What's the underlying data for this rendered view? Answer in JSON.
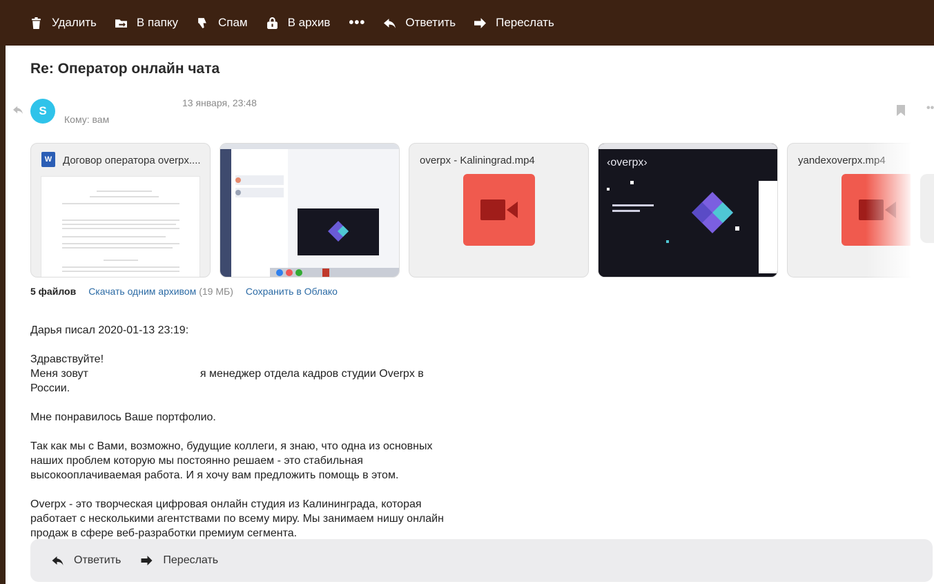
{
  "toolbar": {
    "delete": "Удалить",
    "to_folder": "В папку",
    "spam": "Спам",
    "archive": "В архив",
    "more": "•••",
    "reply": "Ответить",
    "forward": "Переслать"
  },
  "message": {
    "subject": "Re: Оператор онлайн чата",
    "avatar_letter": "S",
    "avatar_color": "#2fc3ea",
    "date": "13 января, 23:48",
    "to": "Кому: вам"
  },
  "attachments": [
    {
      "name": "Договор оператора overpx....",
      "type": "doc"
    },
    {
      "name": "",
      "type": "image"
    },
    {
      "name": "overpx - Kaliningrad.mp4",
      "type": "video"
    },
    {
      "name": "",
      "type": "image"
    },
    {
      "name": "yandexoverpx.mp4",
      "type": "video"
    }
  ],
  "files": {
    "count": "5 файлов",
    "download_all": "Скачать одним архивом",
    "size": "(19 МБ)",
    "save_cloud": "Сохранить в Облако"
  },
  "body": {
    "quote_header": "Дарья писал 2020-01-13 23:19:",
    "greeting": "Здравствуйте!",
    "intro_a": "Меня зовут",
    "intro_b": "я менеджер отдела кадров студии Overpx в России.",
    "p2": "Мне понравилось Ваше портфолио.",
    "p3": "Так как мы с Вами, возможно, будущие коллеги, я знаю, что одна из основных наших проблем которую мы постоянно решаем - это стабильная высокооплачиваемая работа. И я хочу вам предложить помощь в этом.",
    "p4": "Overpx - это творческая цифровая онлайн студия из Калининграда, которая работает с несколькими агентствами по всему миру. Мы занимаем нишу онлайн продаж в сфере веб-разработки премиум сегмента."
  },
  "reply_bar": {
    "reply": "Ответить",
    "forward": "Переслать"
  },
  "colors": {
    "toolbar_bg": "#3d2212",
    "link": "#2c6ba5",
    "video_tile": "#f05a4e"
  }
}
